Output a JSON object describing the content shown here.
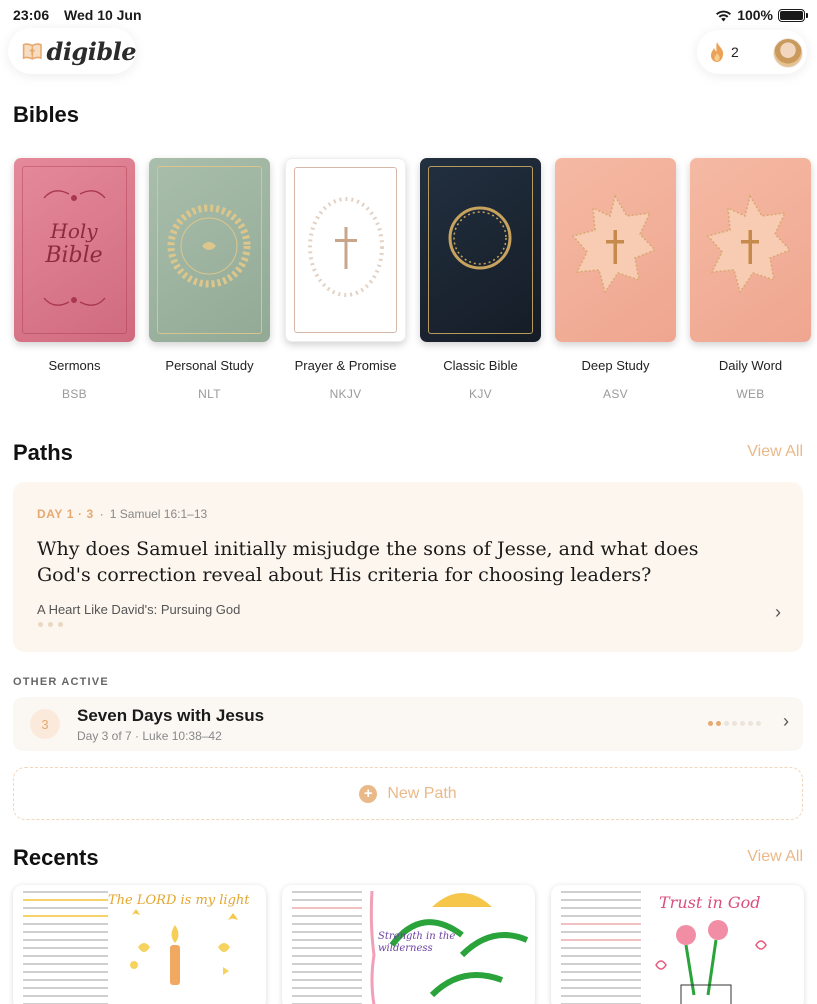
{
  "status_bar": {
    "time": "23:06",
    "date": "Wed 10 Jun",
    "battery": "100%",
    "icons": [
      "wifi-icon",
      "battery-icon"
    ]
  },
  "header": {
    "logo_text": "digible",
    "logo_icon": "bible-book-icon",
    "streak_count": "2",
    "streak_icon": "flame-icon"
  },
  "bibles": {
    "title": "Bibles",
    "items": [
      {
        "name": "Sermons",
        "translation": "BSB",
        "cover_color": "#d97a8c",
        "cover_text": "Holy Bible"
      },
      {
        "name": "Personal Study",
        "translation": "NLT",
        "cover_color": "#9fb5a2"
      },
      {
        "name": "Prayer & Promise",
        "translation": "NKJV",
        "cover_color": "#ffffff"
      },
      {
        "name": "Classic Bible",
        "translation": "KJV",
        "cover_color": "#1c2530"
      },
      {
        "name": "Deep Study",
        "translation": "ASV",
        "cover_color": "#f2b09a"
      },
      {
        "name": "Daily Word",
        "translation": "WEB",
        "cover_color": "#f2b09a"
      }
    ]
  },
  "paths": {
    "title": "Paths",
    "view_all": "View All",
    "featured": {
      "day_label": "DAY 1 · 3",
      "separator": "·",
      "reference": "1 Samuel 16:1–13",
      "question": "Why does Samuel initially misjudge the sons of Jesse, and what does God's correction reveal about His criteria for choosing leaders?",
      "series": "A Heart Like David's: Pursuing God"
    },
    "other_label": "OTHER ACTIVE",
    "other": {
      "number": "3",
      "title": "Seven Days with Jesus",
      "subtitle": "Day 3 of 7 · Luke 10:38–42",
      "progress": 0.286,
      "progress_steps": 7
    },
    "new_path_label": "New Path"
  },
  "recents": {
    "title": "Recents",
    "view_all": "View All",
    "items": [
      {
        "handwriting": "The LORD is my light"
      },
      {
        "handwriting": "Strength in the wilderness"
      },
      {
        "handwriting": "Trust in God"
      }
    ]
  },
  "colors": {
    "accent": "#eab98a",
    "accent_strong": "#e6a970",
    "card_bg": "#fdf6ee"
  }
}
